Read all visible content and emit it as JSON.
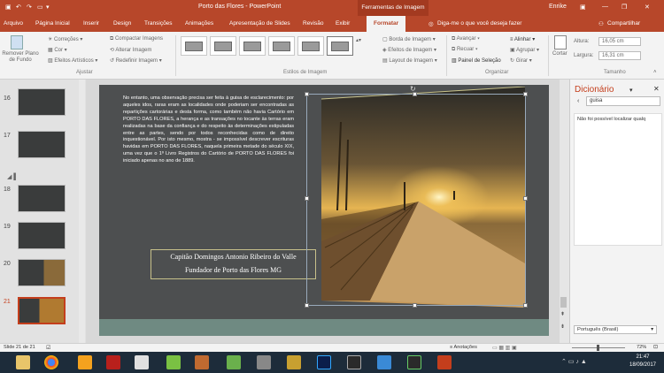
{
  "window": {
    "title": "Porto das Flores  -  PowerPoint",
    "contextual_tab": "Ferramentas de Imagem",
    "user": "Enrike"
  },
  "tabs": [
    "Arquivo",
    "Página Inicial",
    "Inserir",
    "Design",
    "Transições",
    "Animações",
    "Apresentação de Slides",
    "Revisão",
    "Exibir",
    "Formatar"
  ],
  "tell_me": "Diga-me o que você deseja fazer",
  "share": "Compartilhar",
  "ribbon": {
    "remove_bg": "Remover Plano de Fundo",
    "corrections": "Correções",
    "color": "Cor",
    "artistic": "Efeitos Artísticos",
    "compress": "Compactar Imagens",
    "change": "Alterar Imagem",
    "reset": "Redefinir Imagem",
    "group_adjust": "Ajustar",
    "group_styles": "Estilos de Imagem",
    "border": "Borda de Imagem",
    "effects": "Efeitos de Imagem",
    "layout": "Layout de Imagem",
    "forward": "Avançar",
    "backward": "Recuar",
    "selection_pane": "Painel de Seleção",
    "align": "Alinhar",
    "group": "Agrupar",
    "rotate": "Girar",
    "group_arrange": "Organizar",
    "crop": "Cortar",
    "height_label": "Altura:",
    "height_value": "16,05 cm",
    "width_label": "Largura:",
    "width_value": "16,31 cm",
    "group_size": "Tamanho"
  },
  "thumbnails": [
    {
      "num": "16"
    },
    {
      "num": "17"
    },
    {
      "num": "18"
    },
    {
      "num": "19"
    },
    {
      "num": "20"
    },
    {
      "num": "21"
    }
  ],
  "slide": {
    "body_text": "No entanto, uma observação precisa ser feita à guisa de esclarecimento: por aqueles idos, raras eram as localidades onde poderiam ser encontradas as repartições cartorárias e desta forma, como também não havia Cartório em PORTO DAS FLORES, a herança e as transações no tocante às terras eram realizadas na base da confiança e do respeito às determinações estipuladas entre as partes, sendo por todos reconhecidas como de direito inquestionável. Por isto mesmo, mostra - se impossível descrever escrituras havidas em PORTO DAS FLORES, naquela primeira metade do século XIX, uma vez que o 1º Livro Registros do Cartório de PORTO DAS FLORES foi iniciado apenas no ano de 1889.",
    "caption_line1": "Capitão Domingos Antonio Ribeiro do Valle",
    "caption_line2": "Fundador de Porto das Flores   MG"
  },
  "pane": {
    "title": "Dicionário",
    "search_value": "guisa",
    "message": "Não foi possível localizar qualq",
    "language": "Português (Brasil)"
  },
  "status": {
    "slide": "Slide 21 de 21",
    "notes": "Anotações",
    "zoom": "72%"
  },
  "clock": {
    "time": "21:47",
    "date": "18/09/2017"
  }
}
